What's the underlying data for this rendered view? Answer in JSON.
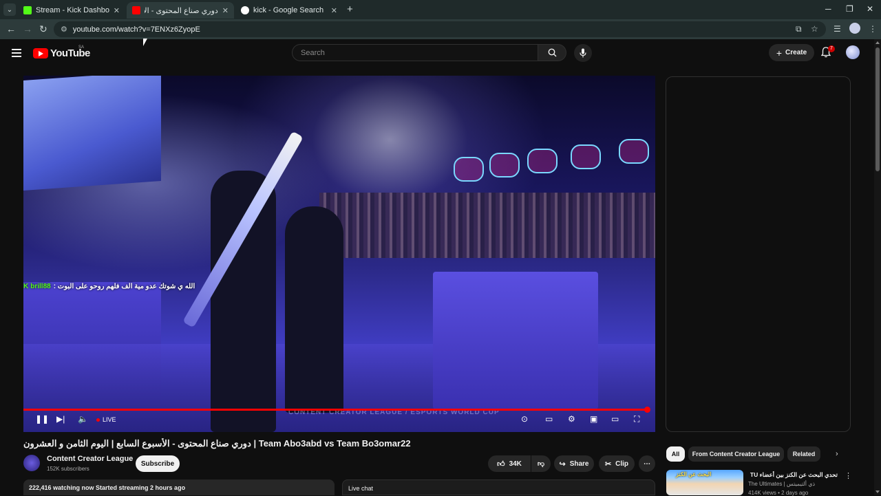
{
  "browser": {
    "tabs": [
      {
        "title": "Stream - Kick Dashboard",
        "favicon_color": "#53fc18",
        "active": false
      },
      {
        "title": "دوري صناع المحتوى - الأ (7)",
        "favicon_color": "#ff0000",
        "active": true
      },
      {
        "title": "kick - Google Search",
        "favicon_color": "#ffffff",
        "active": false
      }
    ],
    "new_tab": "+",
    "url": "youtube.com/watch?v=7ENXz6ZyopE",
    "window_controls": {
      "minimize": "─",
      "maximize": "❐",
      "close": "✕"
    }
  },
  "header": {
    "logo_text": "YouTube",
    "country_code": "SA",
    "search_placeholder": "Search",
    "create_label": "Create",
    "notification_count": "7"
  },
  "player": {
    "chat_overlay": {
      "username": "brill88",
      "message": "الله ي شوتك عدو مية الف فلهم روحو على البوت :"
    },
    "watermark": "CONTENT CREATOR LEAGUE / ESPORTS WORLD CUP",
    "live_label": "LIVE",
    "progress_fraction": 0.995
  },
  "video": {
    "title": "دوري صناع المحتوى - الأسبوع السابع | اليوم الثامن و العشرون | Team Abo3abd vs Team Bo3omar22",
    "channel_name": "Content Creator League",
    "subscribers": "152K subscribers",
    "subscribe_label": "Subscribe",
    "likes": "34K",
    "share_label": "Share",
    "clip_label": "Clip",
    "info_text": "222,416 watching now  Started streaming 2 hours ago",
    "live_chat_label": "Live chat"
  },
  "sidebar": {
    "chips": [
      {
        "label": "All",
        "active": true
      },
      {
        "label": "From Content Creator League",
        "active": false
      },
      {
        "label": "Related",
        "active": false
      }
    ],
    "recommendation": {
      "thumb_text": "البحث عن الكنز",
      "title": "تحدي البحث عن الكنز بين أعضاء TU 🔥",
      "channel": "The Ultimates | ذي ألتيميتس",
      "meta": "414K views • 2 days ago"
    }
  },
  "colors": {
    "accent": "#ff0000",
    "kick_green": "#53fc18",
    "background": "#0f0f0f"
  }
}
